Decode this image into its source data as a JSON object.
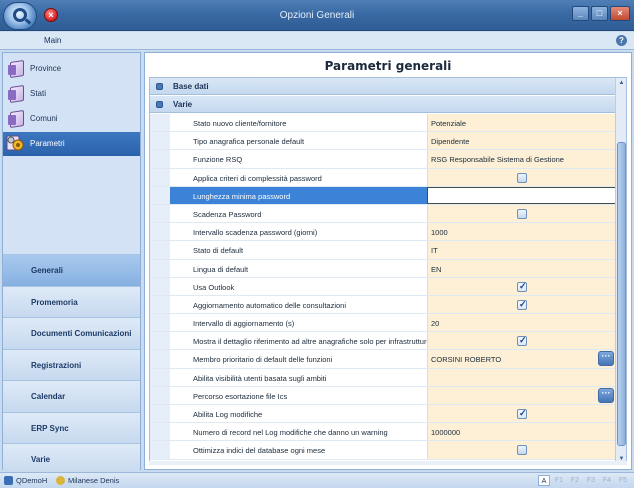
{
  "window": {
    "title": "Opzioni Generali"
  },
  "ribbon": {
    "tab": "Main"
  },
  "nav": {
    "items": [
      {
        "label": "Province",
        "icon": "book-icon"
      },
      {
        "label": "Stati",
        "icon": "book-icon"
      },
      {
        "label": "Comuni",
        "icon": "book-icon"
      },
      {
        "label": "Parametri",
        "icon": "gear-icon"
      }
    ],
    "sections": [
      "Generali",
      "Promemoria",
      "Documenti Comunicazioni",
      "Registrazioni",
      "Calendar",
      "ERP Sync",
      "Varie"
    ]
  },
  "main": {
    "title": "Parametri generali",
    "groups": {
      "base_dati": "Base dati",
      "varie": "Varie"
    },
    "rows": [
      {
        "name": "Stato nuovo cliente/fornitore",
        "value": "Potenziale"
      },
      {
        "name": "Tipo anagrafica personale default",
        "value": "Dipendente"
      },
      {
        "name": "Funzione RSQ",
        "value": "RSG Responsabile Sistema di Gestione"
      },
      {
        "name": "Applica criteri di complessità password",
        "value": "",
        "checkbox": false
      },
      {
        "name": "Lunghezza minima password",
        "value": ""
      },
      {
        "name": "Scadenza Password",
        "value": "",
        "checkbox": false
      },
      {
        "name": "Intervallo scadenza password (giorni)",
        "value": "1000"
      },
      {
        "name": "Stato di default",
        "value": "IT"
      },
      {
        "name": "Lingua di default",
        "value": "EN"
      },
      {
        "name": "Usa Outlook",
        "value": "",
        "checkbox": true
      },
      {
        "name": "Aggiornamento automatico delle consultazioni",
        "value": "",
        "checkbox": true
      },
      {
        "name": "Intervallo di aggiornamento (s)",
        "value": "20"
      },
      {
        "name": "Mostra il dettaglio riferimento ad altre anagrafiche solo per infrastrutture",
        "value": "",
        "checkbox": true
      },
      {
        "name": "Membro prioritario di default delle funzioni",
        "value": "CORSINI ROBERTO",
        "ellipsis": "···"
      },
      {
        "name": "Abilita visibilità utenti basata sugli ambiti",
        "value": ""
      },
      {
        "name": "Percorso esortazione file Ics",
        "value": "",
        "ellipsis": "···"
      },
      {
        "name": "Abilita Log modifiche",
        "value": "",
        "checkbox": true
      },
      {
        "name": "Numero di record nel Log modifiche che danno un warning",
        "value": "1000000"
      },
      {
        "name": "Ottimizza indici del database ogni mese",
        "value": "",
        "checkbox": false
      }
    ]
  },
  "statusbar": {
    "app": "QDemoH",
    "user": "Milanese Denis",
    "keys": [
      "A",
      "F1",
      "F2",
      "F3",
      "F4",
      "F5"
    ]
  },
  "colors": {
    "accent": "#3c82d6",
    "value_bg": "#fdf0d6"
  }
}
